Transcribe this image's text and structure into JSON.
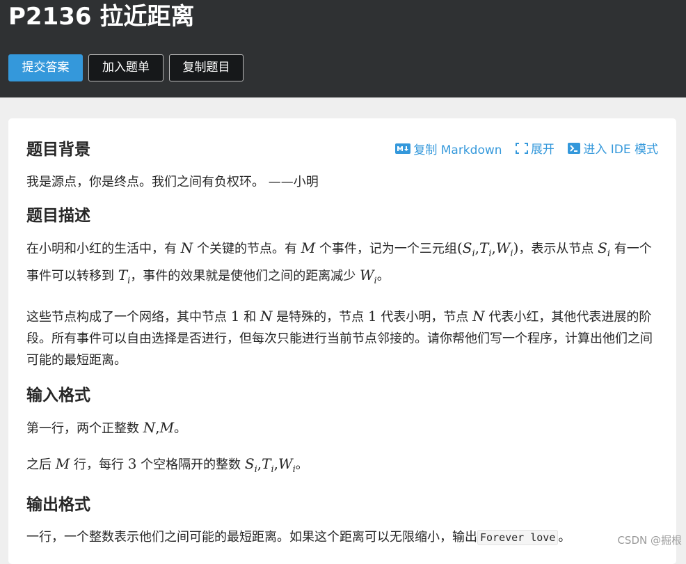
{
  "problem": {
    "title": "P2136 拉近距离"
  },
  "actions": {
    "submit_label": "提交答案",
    "add_list_label": "加入题单",
    "copy_label": "复制题目"
  },
  "toolbar": {
    "markdown_label": "复制 Markdown",
    "expand_label": "展开",
    "ide_label": "进入 IDE 模式"
  },
  "sections": {
    "background": {
      "heading": "题目背景",
      "text": "我是源点，你是终点。我们之间有负权环。 ——小明"
    },
    "description": {
      "heading": "题目描述",
      "p1": {
        "a": "在小明和小红的生活中，有",
        "b": "个关键的节点。有",
        "c": "个事件，记为一个三元组",
        "d": "，表示从节点",
        "e": "有一个事件可以转移到",
        "f": "，事件的效果就是使他们之间的距离减少",
        "g": "。"
      },
      "p2": {
        "a": "这些节点构成了一个网络，其中节点",
        "b": "和",
        "c": "是特殊的，节点",
        "d": "代表小明，节点",
        "e": "代表小红，其他代表进展的阶段。所有事件可以自由选择是否进行，但每次只能进行当前节点邻接的。请你帮他们写一个程序，计算出他们之间可能的最短距离。"
      }
    },
    "input": {
      "heading": "输入格式",
      "line1": {
        "a": "第一行，两个正整数",
        "b": "。"
      },
      "line2": {
        "a": "之后",
        "b": "行，每行",
        "c": "个空格隔开的整数",
        "d": "。"
      }
    },
    "output": {
      "heading": "输出格式",
      "a": "一行，一个整数表示他们之间可能的最短距离。如果这个距离可以无限缩小，输出",
      "code": "Forever love",
      "b": "。"
    }
  },
  "math": {
    "N": "N",
    "M": "M",
    "one": "1",
    "three": "3",
    "S": "S",
    "T": "T",
    "W": "W",
    "i": "i",
    "comma": ",",
    "lparen": "(",
    "rparen": ")"
  },
  "watermark": "CSDN @掘根"
}
